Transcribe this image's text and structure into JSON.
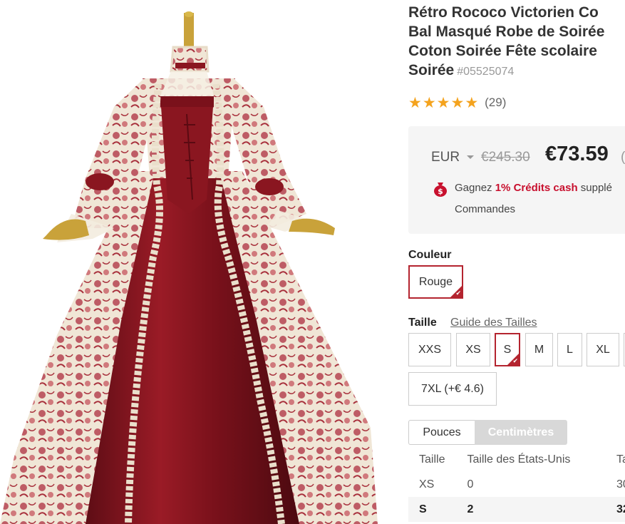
{
  "product": {
    "title_lines": [
      "Rétro Rococo Victorien Co",
      "Bal Masqué Robe de Soirée",
      "Coton Soirée Fête scolaire",
      "Soirée"
    ],
    "sku": "#05525074",
    "rating_count": "(29)",
    "rating_stars": 5
  },
  "price": {
    "currency": "EUR",
    "old_price": "€245.30",
    "current_price": "€73.59",
    "trailing": "(",
    "credits_prefix": "Gagnez ",
    "credits_highlight": "1% Crédits cash",
    "credits_suffix": " supplé",
    "credits_line2": "Commandes"
  },
  "color": {
    "label": "Couleur",
    "options": [
      {
        "label": "Rouge",
        "selected": true
      }
    ]
  },
  "size": {
    "label": "Taille",
    "guide_link": "Guide des Tailles",
    "options": [
      "XXS",
      "XS",
      "S",
      "M",
      "L",
      "XL",
      "7XL (+€ 4.6)"
    ],
    "selected": "S"
  },
  "units": {
    "inches": "Pouces",
    "centimeters": "Centimètres",
    "active": "Centimètres"
  },
  "size_table": {
    "headers": [
      "Taille",
      "Taille des États-Unis",
      "Ta"
    ],
    "rows": [
      [
        "XS",
        "0",
        "30"
      ],
      [
        "S",
        "2",
        "32"
      ]
    ]
  },
  "colors": {
    "accent": "#b4242f",
    "star": "#f4a31e",
    "credit": "#c8102e",
    "dress": "#8a1620"
  },
  "icons": {
    "star": "star-icon",
    "bag": "money-bag-icon",
    "check": "check-icon",
    "caret": "caret-down-icon"
  }
}
